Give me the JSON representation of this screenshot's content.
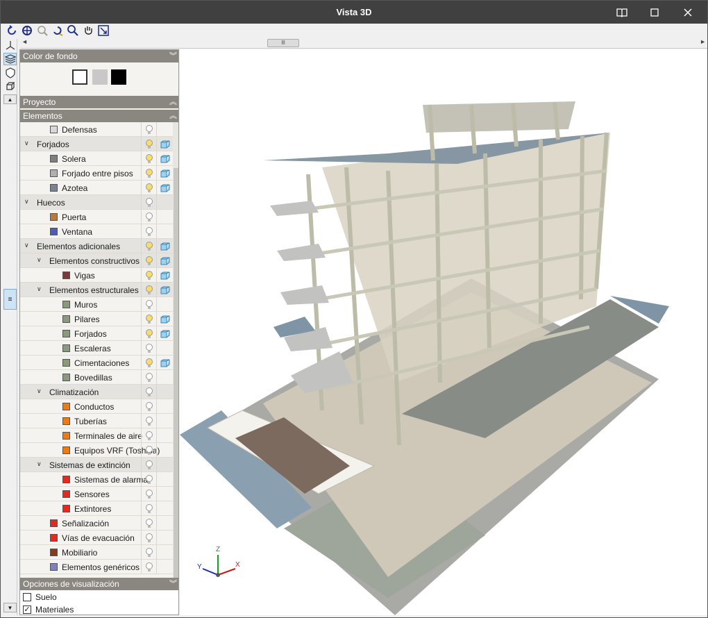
{
  "window": {
    "title": "Vista 3D"
  },
  "colors": {
    "titlebar": "#404040",
    "section_header": "#8a8680",
    "group_row": "#e4e3df"
  },
  "background_color": {
    "header": "Color de fondo",
    "swatches": [
      "#ffffff",
      "#c8c8c8",
      "#000000"
    ]
  },
  "sections": {
    "project": "Proyecto",
    "elements": "Elementos",
    "view_options": "Opciones de visualización"
  },
  "tree": [
    {
      "label": "Defensas",
      "level": 1,
      "group": false,
      "swatch": "#d8d8d8",
      "bulb_on": false,
      "cube": false
    },
    {
      "label": "Forjados",
      "level": 0,
      "group": true,
      "expanded": true,
      "bulb_on": true,
      "cube": true
    },
    {
      "label": "Solera",
      "level": 1,
      "group": false,
      "swatch": "#7f7f7f",
      "bulb_on": true,
      "cube": true
    },
    {
      "label": "Forjado entre pisos",
      "level": 1,
      "group": false,
      "swatch": "#b0b0b0",
      "bulb_on": true,
      "cube": true
    },
    {
      "label": "Azotea",
      "level": 1,
      "group": false,
      "swatch": "#7a8490",
      "bulb_on": true,
      "cube": true
    },
    {
      "label": "Huecos",
      "level": 0,
      "group": true,
      "expanded": true,
      "bulb_on": false,
      "cube": false
    },
    {
      "label": "Puerta",
      "level": 1,
      "group": false,
      "swatch": "#b87a3c",
      "bulb_on": false,
      "cube": false
    },
    {
      "label": "Ventana",
      "level": 1,
      "group": false,
      "swatch": "#4a5cc4",
      "bulb_on": false,
      "cube": false
    },
    {
      "label": "Elementos adicionales",
      "level": 0,
      "group": true,
      "expanded": true,
      "bulb_on": true,
      "cube": true
    },
    {
      "label": "Elementos constructivos",
      "level": 1,
      "group": true,
      "expanded": true,
      "bulb_on": true,
      "cube": true
    },
    {
      "label": "Vigas",
      "level": 2,
      "group": false,
      "swatch": "#7a3a3a",
      "bulb_on": true,
      "cube": true
    },
    {
      "label": "Elementos estructurales",
      "level": 1,
      "group": true,
      "expanded": true,
      "bulb_on": true,
      "cube": true
    },
    {
      "label": "Muros",
      "level": 2,
      "group": false,
      "swatch": "#8a9a7a",
      "bulb_on": false,
      "cube": false
    },
    {
      "label": "Pilares",
      "level": 2,
      "group": false,
      "swatch": "#8a9a7a",
      "bulb_on": true,
      "cube": true
    },
    {
      "label": "Forjados",
      "level": 2,
      "group": false,
      "swatch": "#8a9a7a",
      "bulb_on": true,
      "cube": true
    },
    {
      "label": "Escaleras",
      "level": 2,
      "group": false,
      "swatch": "#8a9a7a",
      "bulb_on": false,
      "cube": false
    },
    {
      "label": "Cimentaciones",
      "level": 2,
      "group": false,
      "swatch": "#8a9a7a",
      "bulb_on": true,
      "cube": true
    },
    {
      "label": "Bovedillas",
      "level": 2,
      "group": false,
      "swatch": "#8a9a7a",
      "bulb_on": false,
      "cube": false
    },
    {
      "label": "Climatización",
      "level": 1,
      "group": true,
      "expanded": true,
      "bulb_on": false,
      "cube": false
    },
    {
      "label": "Conductos",
      "level": 2,
      "group": false,
      "swatch": "#f07a10",
      "bulb_on": false,
      "cube": false
    },
    {
      "label": "Tuberías",
      "level": 2,
      "group": false,
      "swatch": "#f07a10",
      "bulb_on": false,
      "cube": false
    },
    {
      "label": "Terminales de aire",
      "level": 2,
      "group": false,
      "swatch": "#f07a10",
      "bulb_on": false,
      "cube": false
    },
    {
      "label": "Equipos VRF (Toshiba)",
      "level": 2,
      "group": false,
      "swatch": "#f07a10",
      "bulb_on": false,
      "cube": false
    },
    {
      "label": "Sistemas de extinción",
      "level": 1,
      "group": true,
      "expanded": true,
      "bulb_on": false,
      "cube": false
    },
    {
      "label": "Sistemas de alarma",
      "level": 2,
      "group": false,
      "swatch": "#e8281c",
      "bulb_on": false,
      "cube": false
    },
    {
      "label": "Sensores",
      "level": 2,
      "group": false,
      "swatch": "#e8281c",
      "bulb_on": false,
      "cube": false
    },
    {
      "label": "Extintores",
      "level": 2,
      "group": false,
      "swatch": "#e8281c",
      "bulb_on": false,
      "cube": false
    },
    {
      "label": "Señalización",
      "level": 1,
      "group": false,
      "swatch": "#e8281c",
      "bulb_on": false,
      "cube": false
    },
    {
      "label": "Vías de evacuación",
      "level": 1,
      "group": false,
      "swatch": "#e8281c",
      "bulb_on": false,
      "cube": false
    },
    {
      "label": "Mobiliario",
      "level": 1,
      "group": false,
      "swatch": "#8a3a1a",
      "bulb_on": false,
      "cube": false
    },
    {
      "label": "Elementos genéricos",
      "level": 1,
      "group": false,
      "swatch": "#8080c0",
      "bulb_on": false,
      "cube": false
    }
  ],
  "view_options": [
    {
      "label": "Suelo",
      "checked": false
    },
    {
      "label": "Materiales",
      "checked": true
    }
  ],
  "axes": {
    "x": "X",
    "y": "Y",
    "z": "Z"
  },
  "icons": {
    "titlebar": [
      "book-icon",
      "maximize-icon",
      "close-icon"
    ],
    "toolbar": [
      "undo-view-icon",
      "zoom-all-icon",
      "zoom-window-icon",
      "rotate-icon",
      "zoom-icon",
      "pan-hand-icon",
      "fit-view-icon"
    ],
    "side": [
      "axis-icon",
      "layers-icon",
      "shield-icon",
      "cube-icon"
    ]
  }
}
